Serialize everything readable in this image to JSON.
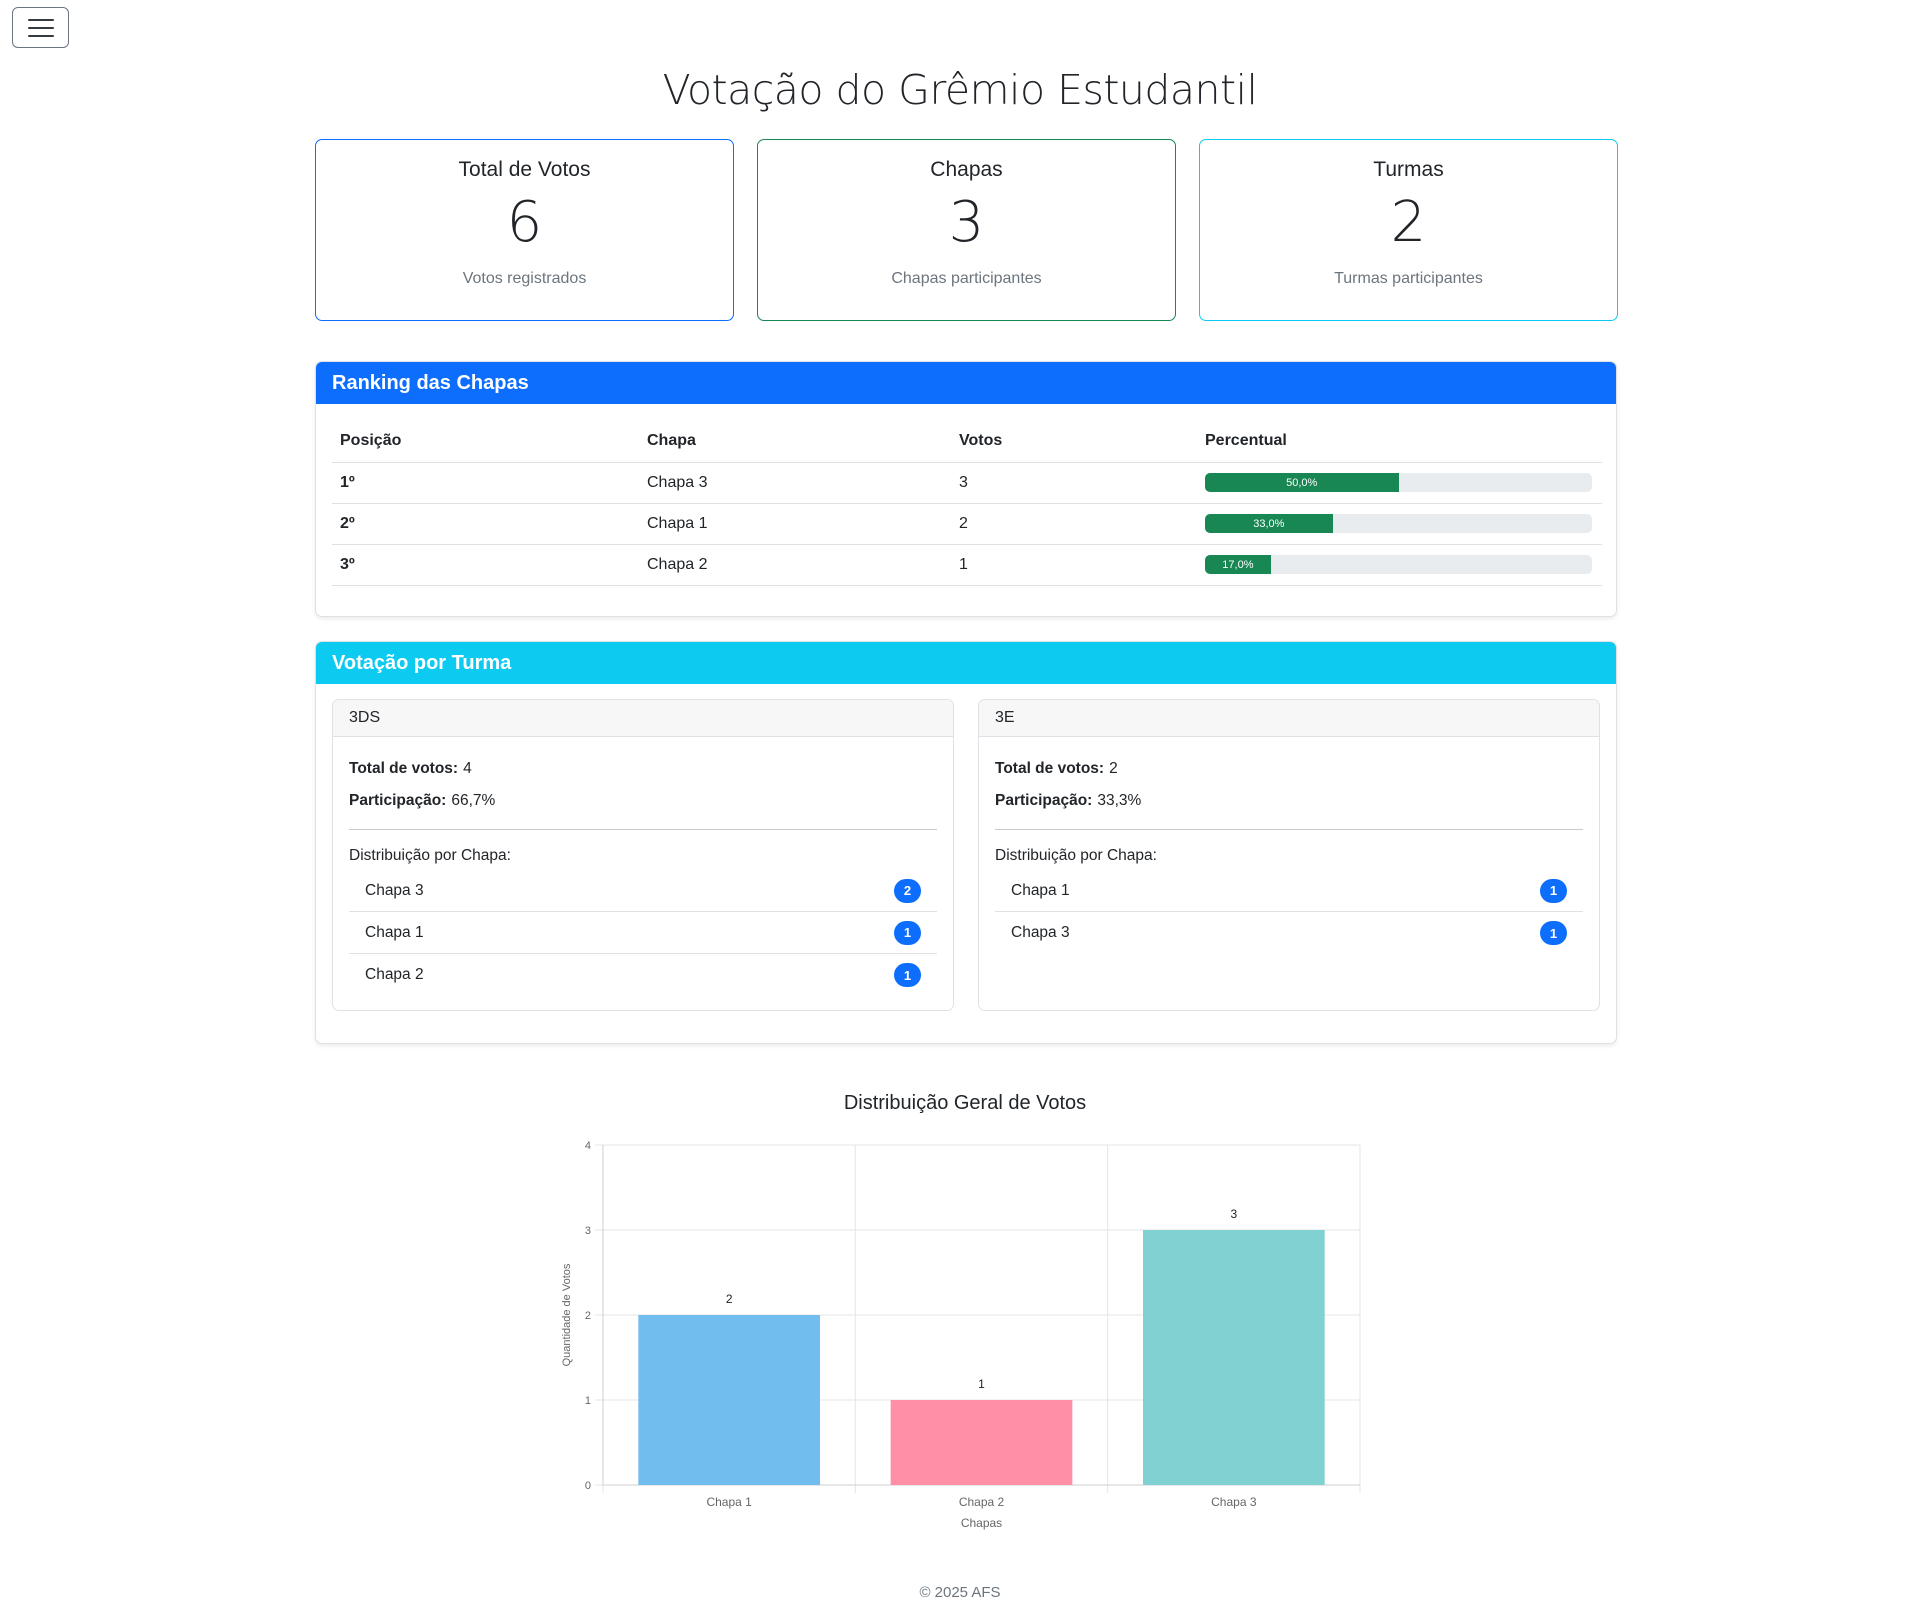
{
  "menu": {
    "icon": "hamburger-icon"
  },
  "page_title": "Votação do Grêmio Estudantil",
  "stats": [
    {
      "title": "Total de Votos",
      "value": "6",
      "subtitle": "Votos registrados",
      "color": "#0d6efd"
    },
    {
      "title": "Chapas",
      "value": "3",
      "subtitle": "Chapas participantes",
      "color": "#198754"
    },
    {
      "title": "Turmas",
      "value": "2",
      "subtitle": "Turmas participantes",
      "color": "#0dcaf0"
    }
  ],
  "ranking": {
    "title": "Ranking das Chapas",
    "headers": [
      "Posição",
      "Chapa",
      "Votos",
      "Percentual"
    ],
    "rows": [
      {
        "pos": "1º",
        "chapa": "Chapa 3",
        "votos": "3",
        "percent_label": "50,0%",
        "percent": 50.0
      },
      {
        "pos": "2º",
        "chapa": "Chapa 1",
        "votos": "2",
        "percent_label": "33,0%",
        "percent": 33.0
      },
      {
        "pos": "3º",
        "chapa": "Chapa 2",
        "votos": "1",
        "percent_label": "17,0%",
        "percent": 17.0
      }
    ]
  },
  "turmas": {
    "title": "Votação por Turma",
    "total_label": "Total de votos:",
    "part_label": "Participação:",
    "dist_label": "Distribuição por Chapa:",
    "items": [
      {
        "name": "3DS",
        "total": "4",
        "participation": "66,7%",
        "dist": [
          {
            "chapa": "Chapa 3",
            "count": "2"
          },
          {
            "chapa": "Chapa 1",
            "count": "1"
          },
          {
            "chapa": "Chapa 2",
            "count": "1"
          }
        ]
      },
      {
        "name": "3E",
        "total": "2",
        "participation": "33,3%",
        "dist": [
          {
            "chapa": "Chapa 1",
            "count": "1"
          },
          {
            "chapa": "Chapa 3",
            "count": "1"
          }
        ]
      }
    ]
  },
  "chart_data": {
    "type": "bar",
    "title": "Distribuição Geral de Votos",
    "categories": [
      "Chapa 1",
      "Chapa 2",
      "Chapa 3"
    ],
    "values": [
      2,
      1,
      3
    ],
    "colors": [
      "#71bdee",
      "#ff8fa6",
      "#80d1d2"
    ],
    "xlabel": "Chapas",
    "ylabel": "Quantidade de Votos",
    "ylim": [
      0,
      4
    ],
    "yticks": [
      0,
      1,
      2,
      3,
      4
    ],
    "grid": true,
    "data_labels": [
      "2",
      "1",
      "3"
    ]
  },
  "footer": "© 2025 AFS"
}
